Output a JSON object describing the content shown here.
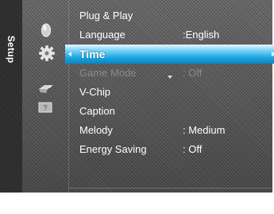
{
  "sidebar": {
    "title": "Setup"
  },
  "categories": [
    {
      "icon": "picture-icon"
    },
    {
      "icon": "setup-gear-icon"
    },
    {
      "icon": "input-icon"
    },
    {
      "icon": "support-icon"
    }
  ],
  "menu": {
    "items": [
      {
        "label": "Plug & Play",
        "value": "",
        "state": "normal"
      },
      {
        "label": "Language",
        "value": ":English",
        "state": "normal"
      },
      {
        "label": "Time",
        "value": "",
        "state": "selected"
      },
      {
        "label": "Game Mode",
        "value": ": Off",
        "state": "disabled"
      },
      {
        "label": "V-Chip",
        "value": "",
        "state": "normal"
      },
      {
        "label": "Caption",
        "value": "",
        "state": "normal"
      },
      {
        "label": "Melody",
        "value": ": Medium",
        "state": "normal"
      },
      {
        "label": "Energy Saving",
        "value": ": Off",
        "state": "normal"
      }
    ]
  },
  "colors": {
    "highlight": "#18a4e0",
    "background": "#5a5a5a",
    "text": "#ffffff",
    "disabled_text": "#8a8a8a"
  }
}
